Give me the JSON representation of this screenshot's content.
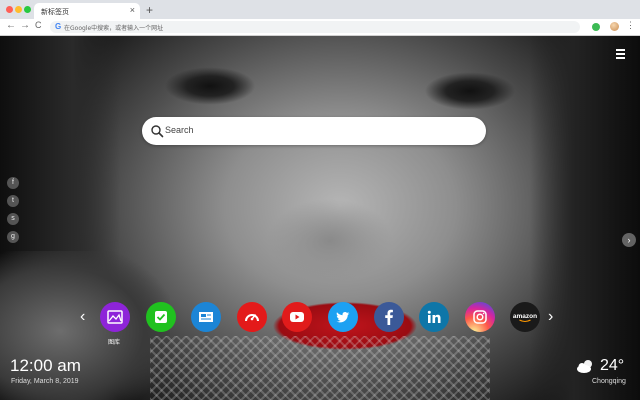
{
  "browser": {
    "tab_title": "新标签页",
    "tab_close": "×",
    "new_tab": "+",
    "omnibox_placeholder": "在Google中搜索，或者输入一个网址",
    "nav": {
      "back": "←",
      "forward": "→",
      "reload": "C"
    },
    "menu": "⋮"
  },
  "search": {
    "placeholder": "Search"
  },
  "apps": [
    {
      "name": "图库",
      "label": "图库",
      "color": "#8e24d9",
      "icon": "gallery-icon"
    },
    {
      "name": "check",
      "color": "#20c11f",
      "icon": "check-icon"
    },
    {
      "name": "news",
      "color": "#1c85d6",
      "icon": "newspaper-icon"
    },
    {
      "name": "speed",
      "color": "#e31a1a",
      "icon": "gauge-icon"
    },
    {
      "name": "youtube",
      "color": "#e11b1b",
      "icon": "youtube-icon"
    },
    {
      "name": "twitter",
      "color": "#1da1f2",
      "icon": "twitter-icon"
    },
    {
      "name": "facebook",
      "color": "#3b5998",
      "icon": "facebook-icon"
    },
    {
      "name": "linkedin",
      "color": "#0e76a8",
      "icon": "linkedin-icon"
    },
    {
      "name": "instagram",
      "color": "#d6249f",
      "icon": "instagram-icon"
    },
    {
      "name": "amazon",
      "label": "amazon",
      "color": "#1a1a1a",
      "icon": "amazon-icon"
    }
  ],
  "social_icons": [
    "f",
    "t",
    "s",
    "g"
  ],
  "clock": {
    "time": "12:00 am",
    "date": "Friday, March 8, 2019"
  },
  "weather": {
    "temp": "24°",
    "city": "Chongqing"
  }
}
